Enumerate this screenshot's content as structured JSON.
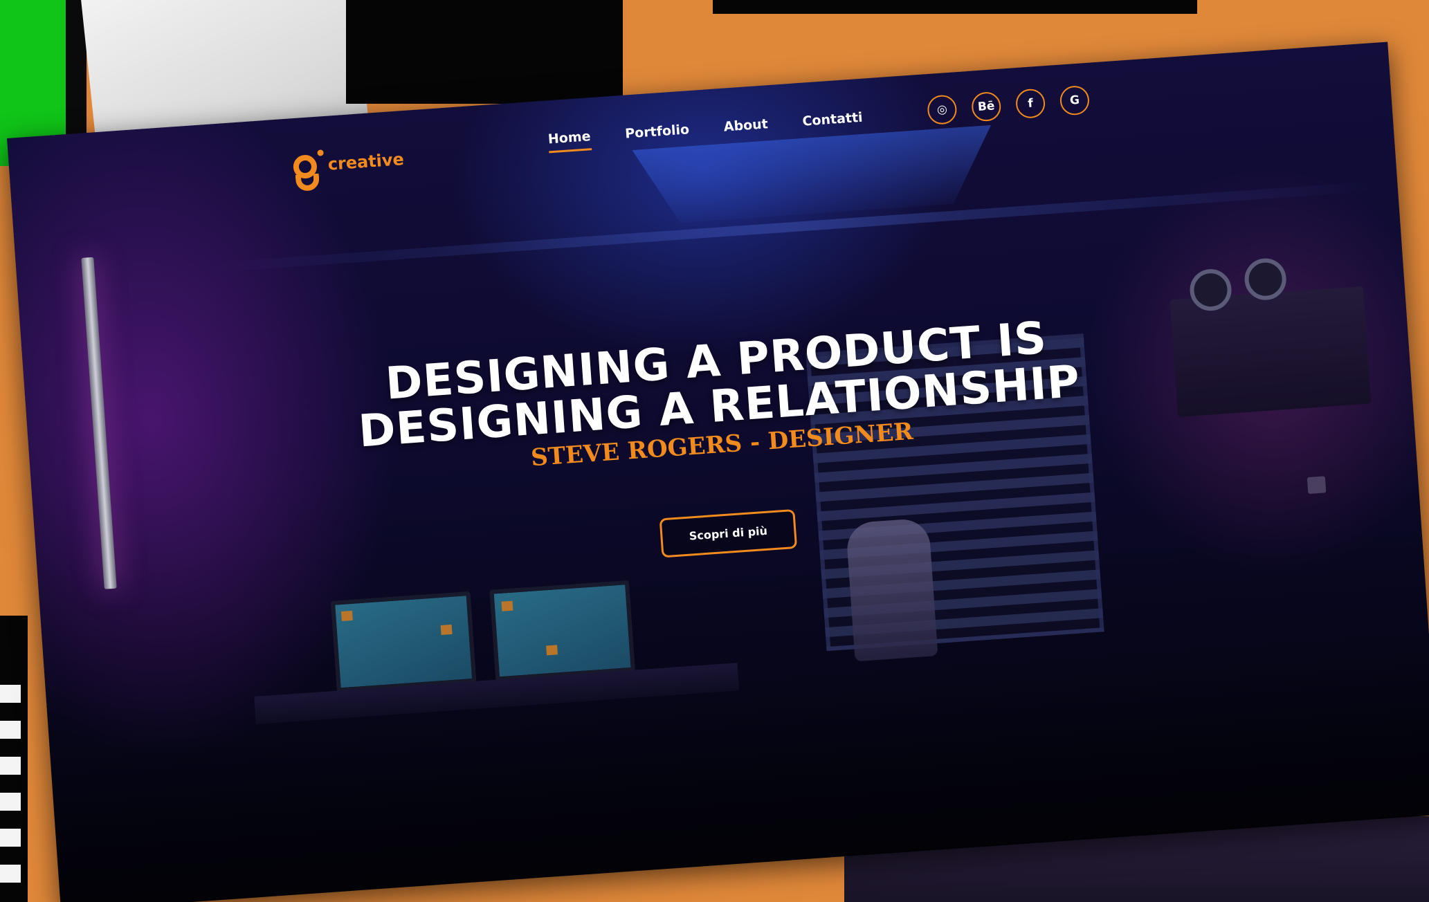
{
  "brand": {
    "logo_text": "creative",
    "accent_color": "#f28b1e"
  },
  "nav": {
    "items": [
      {
        "label": "Home",
        "active": true
      },
      {
        "label": "Portfolio",
        "active": false
      },
      {
        "label": "About",
        "active": false
      },
      {
        "label": "Contatti",
        "active": false
      }
    ]
  },
  "socials": [
    {
      "icon": "instagram-icon",
      "glyph": "◎"
    },
    {
      "icon": "behance-icon",
      "glyph": "Bē"
    },
    {
      "icon": "facebook-icon",
      "glyph": "f"
    },
    {
      "icon": "google-icon",
      "glyph": "G"
    }
  ],
  "hero": {
    "title_line1": "DESIGNING A PRODUCT IS",
    "title_line2": "DESIGNING A RELATIONSHIP",
    "subtitle": "STEVE ROGERS - DESIGNER",
    "cta_label": "Scopri di più"
  }
}
